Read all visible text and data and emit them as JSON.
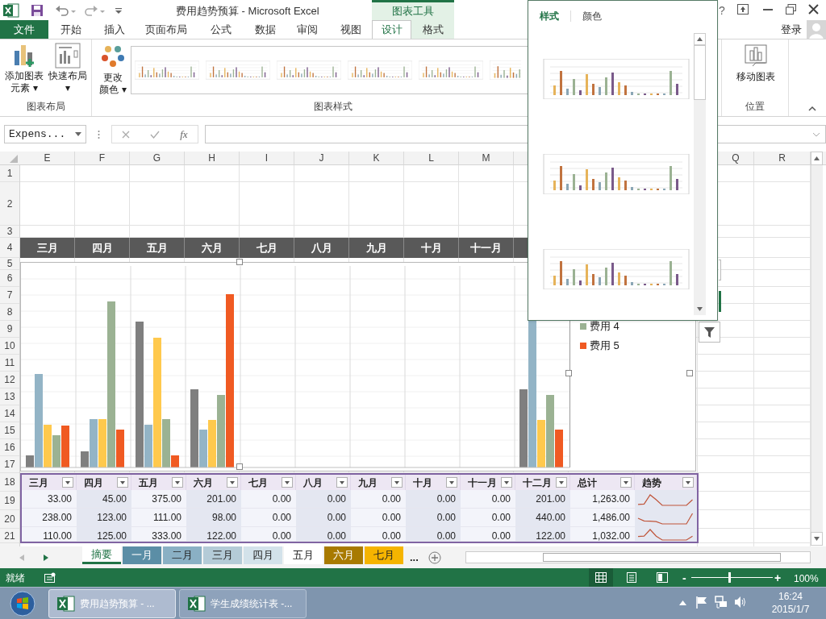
{
  "title_bar": {
    "title": "费用趋势预算 - Microsoft Excel",
    "context_tab": "图表工具",
    "help": "?"
  },
  "ribbon_tabs": [
    {
      "label": "文件",
      "kind": "file",
      "selected": false
    },
    {
      "label": "开始",
      "kind": "normal",
      "selected": false
    },
    {
      "label": "插入",
      "kind": "normal",
      "selected": false
    },
    {
      "label": "页面布局",
      "kind": "normal",
      "selected": false
    },
    {
      "label": "公式",
      "kind": "normal",
      "selected": false
    },
    {
      "label": "数据",
      "kind": "normal",
      "selected": false
    },
    {
      "label": "审阅",
      "kind": "normal",
      "selected": false
    },
    {
      "label": "视图",
      "kind": "normal",
      "selected": false
    },
    {
      "label": "设计",
      "kind": "context",
      "selected": true
    },
    {
      "label": "格式",
      "kind": "context",
      "selected": false
    }
  ],
  "account": {
    "label": "登录"
  },
  "ribbon_groups": {
    "layout": {
      "label": "图表布局",
      "add_element": [
        "添加图表",
        "元素 ▾"
      ],
      "quick_layout": [
        "快速布局",
        "▾"
      ]
    },
    "styles": {
      "label": "图表样式",
      "change_colors": [
        "更改",
        "颜色 ▾"
      ]
    },
    "location": {
      "label": "位置",
      "move_chart": "移动图表"
    }
  },
  "formula_bar": {
    "name_box": "Expens...",
    "fx": "fx"
  },
  "column_headers_left": [
    "E",
    "F",
    "G",
    "H",
    "I",
    "J",
    "K",
    "L",
    "M"
  ],
  "column_headers_right": [
    "Q",
    "R"
  ],
  "row_numbers": [
    "1",
    "2",
    "3",
    "4",
    "5",
    "6",
    "7",
    "8",
    "9",
    "10",
    "11",
    "12",
    "13",
    "14",
    "15",
    "16",
    "17",
    "18",
    "19",
    "20",
    "21"
  ],
  "month_bar": [
    "三月",
    "四月",
    "五月",
    "六月",
    "七月",
    "八月",
    "九月",
    "十月",
    "十一月"
  ],
  "chart": {
    "legend": [
      {
        "label": "费用 4",
        "color": "#9bb293"
      },
      {
        "label": "费用 5",
        "color": "#f05a22"
      }
    ]
  },
  "table": {
    "columns": [
      "三月",
      "四月",
      "五月",
      "六月",
      "七月",
      "八月",
      "九月",
      "十月",
      "十一月",
      "十二月",
      "总计",
      "趋势"
    ],
    "rows": [
      [
        "33.00",
        "45.00",
        "375.00",
        "201.00",
        "0.00",
        "0.00",
        "0.00",
        "0.00",
        "0.00",
        "201.00",
        "1,263.00"
      ],
      [
        "238.00",
        "123.00",
        "111.00",
        "98.00",
        "0.00",
        "0.00",
        "0.00",
        "0.00",
        "0.00",
        "440.00",
        "1,486.00"
      ],
      [
        "110.00",
        "125.00",
        "333.00",
        "122.00",
        "0.00",
        "0.00",
        "0.00",
        "0.00",
        "0.00",
        "122.00",
        "1,032.00"
      ]
    ]
  },
  "style_pane": {
    "tabs": [
      {
        "label": "样式",
        "selected": true
      },
      {
        "label": "颜色",
        "selected": false
      }
    ]
  },
  "sheet_tabs": [
    {
      "label": "摘要",
      "selected": true,
      "color": "#217346"
    },
    {
      "label": "一月",
      "selected": false,
      "color": "#5b8ea6"
    },
    {
      "label": "二月",
      "selected": false,
      "color": "#8ab0c4"
    },
    {
      "label": "三月",
      "selected": false,
      "color": "#b4cbd7"
    },
    {
      "label": "四月",
      "selected": false,
      "color": "#d3e2ea"
    },
    {
      "label": "五月",
      "selected": false
    },
    {
      "label": "六月",
      "selected": false,
      "color": "#a87a00"
    },
    {
      "label": "七月",
      "selected": false,
      "color": "#f5b400"
    }
  ],
  "sheet_more": "...",
  "status_bar": {
    "text": "就绪",
    "zoom": {
      "level": 0.47,
      "label": "100%",
      "minus": "-",
      "plus": "+"
    }
  },
  "taskbar": {
    "tasks": [
      {
        "label": "费用趋势预算 - ...",
        "selected": true
      },
      {
        "label": "学生成绩统计表 -...",
        "selected": false
      }
    ],
    "time": "16:24",
    "date": "2015/1/7"
  }
}
